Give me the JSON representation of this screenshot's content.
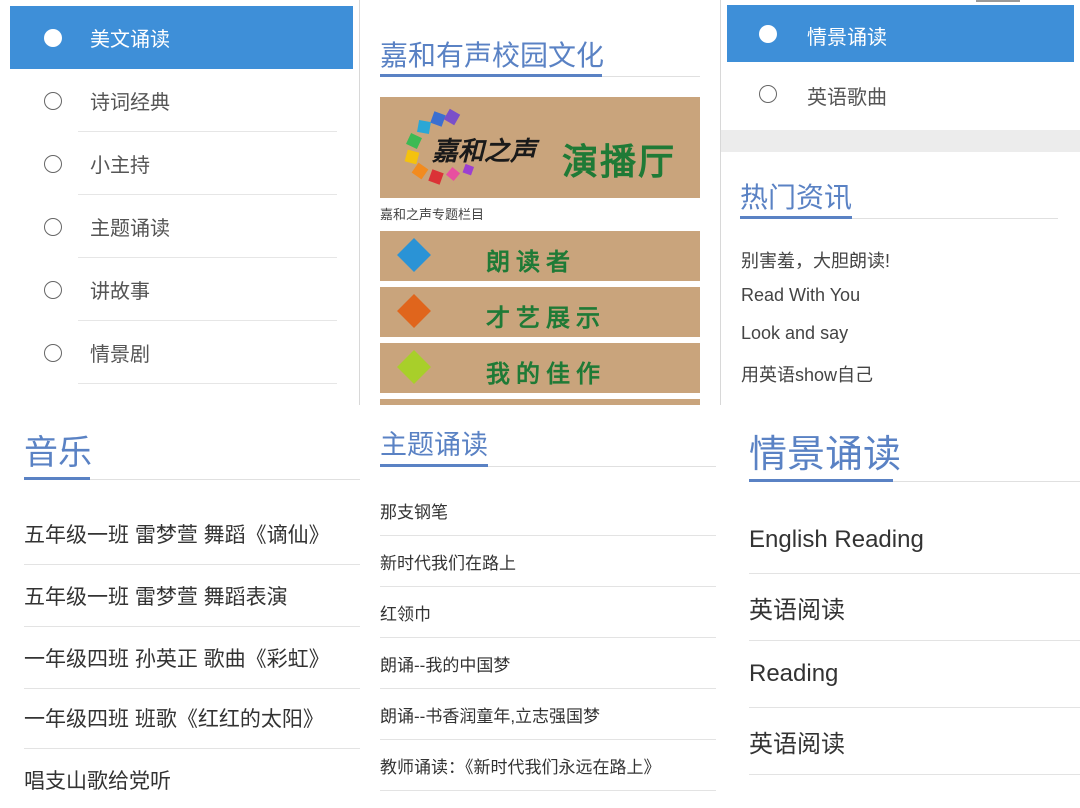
{
  "panel_left_menu": {
    "items": [
      {
        "label": "美文诵读",
        "selected": true
      },
      {
        "label": "诗词经典",
        "selected": false
      },
      {
        "label": "小主持",
        "selected": false
      },
      {
        "label": "主题诵读",
        "selected": false
      },
      {
        "label": "讲故事",
        "selected": false
      },
      {
        "label": "情景剧",
        "selected": false
      }
    ]
  },
  "panel_campus": {
    "title": "嘉和有声校园文化",
    "hero_logo_text": "嘉和之声",
    "hero_text": "演播厅",
    "caption": "嘉和之声专题栏目",
    "banners": [
      {
        "label": "朗读者",
        "diamond_color": "#2a93d6"
      },
      {
        "label": "才艺展示",
        "diamond_color": "#e0651c"
      },
      {
        "label": "我的佳作",
        "diamond_color": "#a8cf2a"
      }
    ],
    "banner_color": "#c9a47c",
    "banner_text_color": "#1f7a36"
  },
  "panel_top_right": {
    "menu_items": [
      {
        "label": "情景诵读",
        "selected": true
      },
      {
        "label": "英语歌曲",
        "selected": false
      }
    ],
    "news_title": "热门资讯",
    "news": [
      "别害羞，大胆朗读!",
      "Read With You",
      "Look and say",
      "用英语show自己"
    ]
  },
  "panel_music": {
    "title": "音乐",
    "items": [
      "五年级一班 雷梦萱 舞蹈《谪仙》",
      "五年级一班 雷梦萱 舞蹈表演",
      "一年级四班 孙英正 歌曲《彩虹》",
      "一年级四班 班歌《红红的太阳》",
      "唱支山歌给党听"
    ]
  },
  "panel_theme_reading": {
    "title": "主题诵读",
    "items": [
      "那支钢笔",
      "新时代我们在路上",
      "红领巾",
      "朗诵--我的中国梦",
      "朗诵--书香润童年,立志强国梦",
      "教师诵读：《新时代我们永远在路上》"
    ]
  },
  "panel_scene_reading": {
    "title": "情景诵读",
    "items": [
      "English Reading",
      "英语阅读",
      "Reading",
      "英语阅读"
    ]
  },
  "colors": {
    "accent_blue": "#3e8fd8",
    "title_blue": "#5a82c4"
  }
}
